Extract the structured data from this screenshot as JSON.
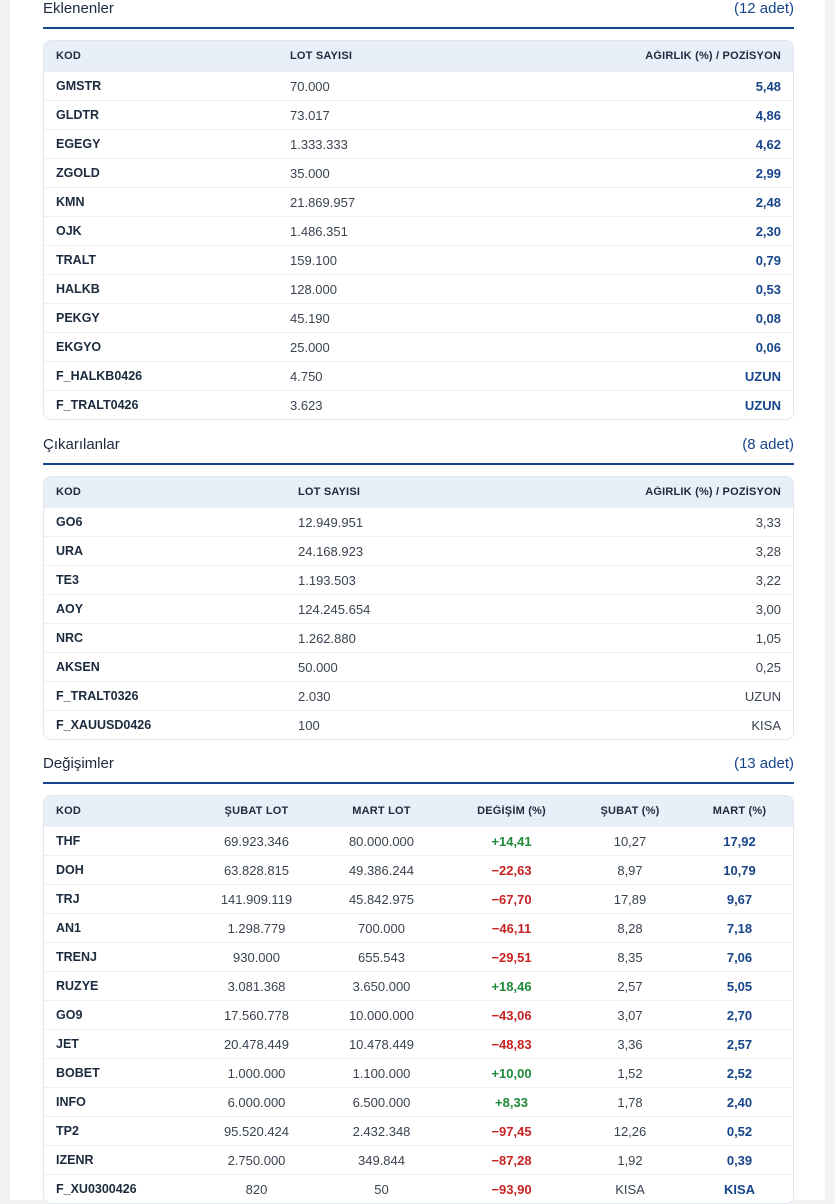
{
  "added": {
    "title": "Eklenenler",
    "count": "(12 adet)",
    "headers": {
      "kod": "KOD",
      "lot": "LOT SAYISI",
      "weight": "AĞIRLIK (%) / POZİSYON"
    },
    "rows": [
      {
        "kod": "GMSTR",
        "lot": "70.000",
        "weight": "5,48"
      },
      {
        "kod": "GLDTR",
        "lot": "73.017",
        "weight": "4,86"
      },
      {
        "kod": "EGEGY",
        "lot": "1.333.333",
        "weight": "4,62"
      },
      {
        "kod": "ZGOLD",
        "lot": "35.000",
        "weight": "2,99"
      },
      {
        "kod": "KMN",
        "lot": "21.869.957",
        "weight": "2,48"
      },
      {
        "kod": "OJK",
        "lot": "1.486.351",
        "weight": "2,30"
      },
      {
        "kod": "TRALT",
        "lot": "159.100",
        "weight": "0,79"
      },
      {
        "kod": "HALKB",
        "lot": "128.000",
        "weight": "0,53"
      },
      {
        "kod": "PEKGY",
        "lot": "45.190",
        "weight": "0,08"
      },
      {
        "kod": "EKGYO",
        "lot": "25.000",
        "weight": "0,06"
      },
      {
        "kod": "F_HALKB0426",
        "lot": "4.750",
        "weight": "UZUN"
      },
      {
        "kod": "F_TRALT0426",
        "lot": "3.623",
        "weight": "UZUN"
      }
    ]
  },
  "removed": {
    "title": "Çıkarılanlar",
    "count": "(8 adet)",
    "headers": {
      "kod": "KOD",
      "lot": "LOT SAYISI",
      "weight": "AĞIRLIK (%) / POZİSYON"
    },
    "rows": [
      {
        "kod": "GO6",
        "lot": "12.949.951",
        "weight": "3,33"
      },
      {
        "kod": "URA",
        "lot": "24.168.923",
        "weight": "3,28"
      },
      {
        "kod": "TE3",
        "lot": "1.193.503",
        "weight": "3,22"
      },
      {
        "kod": "AOY",
        "lot": "124.245.654",
        "weight": "3,00"
      },
      {
        "kod": "NRC",
        "lot": "1.262.880",
        "weight": "1,05"
      },
      {
        "kod": "AKSEN",
        "lot": "50.000",
        "weight": "0,25"
      },
      {
        "kod": "F_TRALT0326",
        "lot": "2.030",
        "weight": "UZUN"
      },
      {
        "kod": "F_XAUUSD0426",
        "lot": "100",
        "weight": "KISA"
      }
    ]
  },
  "changes": {
    "title": "Değişimler",
    "count": "(13 adet)",
    "headers": {
      "kod": "KOD",
      "feb_lot": "ŞUBAT LOT",
      "mar_lot": "MART LOT",
      "change": "DEĞİŞİM (%)",
      "feb_pct": "ŞUBAT (%)",
      "mar_pct": "MART (%)"
    },
    "rows": [
      {
        "kod": "THF",
        "feb_lot": "69.923.346",
        "mar_lot": "80.000.000",
        "change": "+14,41",
        "dir": "up",
        "feb_pct": "10,27",
        "mar_pct": "17,92"
      },
      {
        "kod": "DOH",
        "feb_lot": "63.828.815",
        "mar_lot": "49.386.244",
        "change": "−22,63",
        "dir": "down",
        "feb_pct": "8,97",
        "mar_pct": "10,79"
      },
      {
        "kod": "TRJ",
        "feb_lot": "141.909.119",
        "mar_lot": "45.842.975",
        "change": "−67,70",
        "dir": "down",
        "feb_pct": "17,89",
        "mar_pct": "9,67"
      },
      {
        "kod": "AN1",
        "feb_lot": "1.298.779",
        "mar_lot": "700.000",
        "change": "−46,11",
        "dir": "down",
        "feb_pct": "8,28",
        "mar_pct": "7,18"
      },
      {
        "kod": "TRENJ",
        "feb_lot": "930.000",
        "mar_lot": "655.543",
        "change": "−29,51",
        "dir": "down",
        "feb_pct": "8,35",
        "mar_pct": "7,06"
      },
      {
        "kod": "RUZYE",
        "feb_lot": "3.081.368",
        "mar_lot": "3.650.000",
        "change": "+18,46",
        "dir": "up",
        "feb_pct": "2,57",
        "mar_pct": "5,05"
      },
      {
        "kod": "GO9",
        "feb_lot": "17.560.778",
        "mar_lot": "10.000.000",
        "change": "−43,06",
        "dir": "down",
        "feb_pct": "3,07",
        "mar_pct": "2,70"
      },
      {
        "kod": "JET",
        "feb_lot": "20.478.449",
        "mar_lot": "10.478.449",
        "change": "−48,83",
        "dir": "down",
        "feb_pct": "3,36",
        "mar_pct": "2,57"
      },
      {
        "kod": "BOBET",
        "feb_lot": "1.000.000",
        "mar_lot": "1.100.000",
        "change": "+10,00",
        "dir": "up",
        "feb_pct": "1,52",
        "mar_pct": "2,52"
      },
      {
        "kod": "INFO",
        "feb_lot": "6.000.000",
        "mar_lot": "6.500.000",
        "change": "+8,33",
        "dir": "up",
        "feb_pct": "1,78",
        "mar_pct": "2,40"
      },
      {
        "kod": "TP2",
        "feb_lot": "95.520.424",
        "mar_lot": "2.432.348",
        "change": "−97,45",
        "dir": "down",
        "feb_pct": "12,26",
        "mar_pct": "0,52"
      },
      {
        "kod": "IZENR",
        "feb_lot": "2.750.000",
        "mar_lot": "349.844",
        "change": "−87,28",
        "dir": "down",
        "feb_pct": "1,92",
        "mar_pct": "0,39"
      },
      {
        "kod": "F_XU0300426",
        "feb_lot": "820",
        "mar_lot": "50",
        "change": "−93,90",
        "dir": "down",
        "feb_pct": "KISA",
        "mar_pct": "KISA"
      }
    ]
  },
  "colors": {
    "accent": "#17458a",
    "positive": "#1e8a3a",
    "negative": "#c82323",
    "header_bg": "#e9eff9"
  }
}
